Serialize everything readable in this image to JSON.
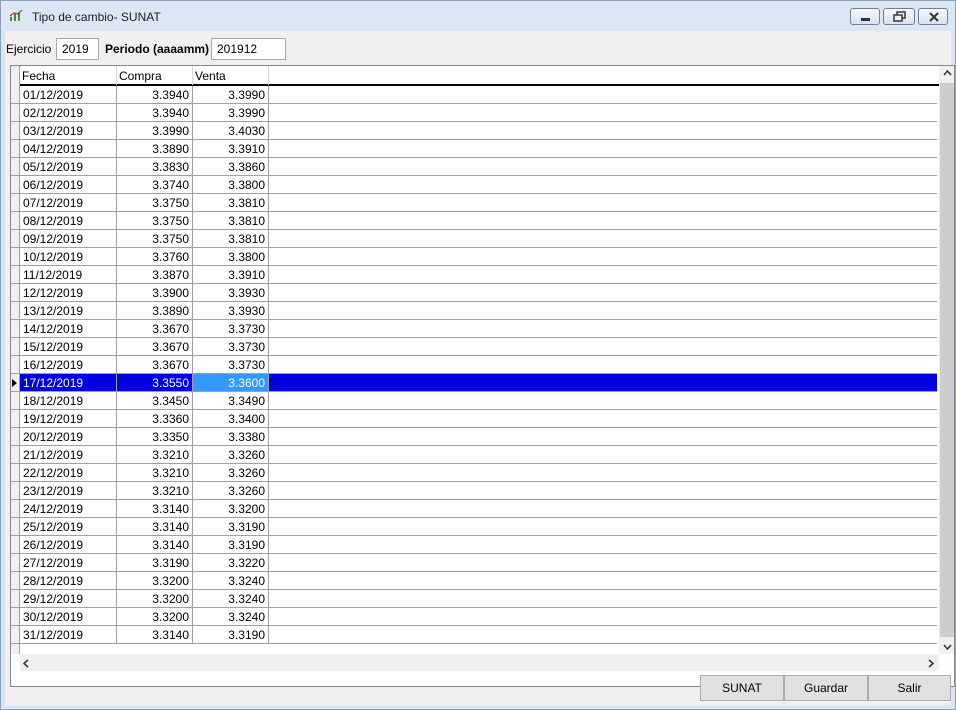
{
  "window": {
    "title": "Tipo de cambio- SUNAT"
  },
  "filters": {
    "ejercicio_label": "Ejercicio",
    "ejercicio_value": "2019",
    "periodo_label": "Periodo (aaaamm)",
    "periodo_value": "201912"
  },
  "grid": {
    "columns": [
      "Fecha",
      "Compra",
      "Venta"
    ],
    "selected_index": 16,
    "rows": [
      {
        "fecha": "01/12/2019",
        "compra": "3.3940",
        "venta": "3.3990"
      },
      {
        "fecha": "02/12/2019",
        "compra": "3.3940",
        "venta": "3.3990"
      },
      {
        "fecha": "03/12/2019",
        "compra": "3.3990",
        "venta": "3.4030"
      },
      {
        "fecha": "04/12/2019",
        "compra": "3.3890",
        "venta": "3.3910"
      },
      {
        "fecha": "05/12/2019",
        "compra": "3.3830",
        "venta": "3.3860"
      },
      {
        "fecha": "06/12/2019",
        "compra": "3.3740",
        "venta": "3.3800"
      },
      {
        "fecha": "07/12/2019",
        "compra": "3.3750",
        "venta": "3.3810"
      },
      {
        "fecha": "08/12/2019",
        "compra": "3.3750",
        "venta": "3.3810"
      },
      {
        "fecha": "09/12/2019",
        "compra": "3.3750",
        "venta": "3.3810"
      },
      {
        "fecha": "10/12/2019",
        "compra": "3.3760",
        "venta": "3.3800"
      },
      {
        "fecha": "11/12/2019",
        "compra": "3.3870",
        "venta": "3.3910"
      },
      {
        "fecha": "12/12/2019",
        "compra": "3.3900",
        "venta": "3.3930"
      },
      {
        "fecha": "13/12/2019",
        "compra": "3.3890",
        "venta": "3.3930"
      },
      {
        "fecha": "14/12/2019",
        "compra": "3.3670",
        "venta": "3.3730"
      },
      {
        "fecha": "15/12/2019",
        "compra": "3.3670",
        "venta": "3.3730"
      },
      {
        "fecha": "16/12/2019",
        "compra": "3.3670",
        "venta": "3.3730"
      },
      {
        "fecha": "17/12/2019",
        "compra": "3.3550",
        "venta": "3.3600"
      },
      {
        "fecha": "18/12/2019",
        "compra": "3.3450",
        "venta": "3.3490"
      },
      {
        "fecha": "19/12/2019",
        "compra": "3.3360",
        "venta": "3.3400"
      },
      {
        "fecha": "20/12/2019",
        "compra": "3.3350",
        "venta": "3.3380"
      },
      {
        "fecha": "21/12/2019",
        "compra": "3.3210",
        "venta": "3.3260"
      },
      {
        "fecha": "22/12/2019",
        "compra": "3.3210",
        "venta": "3.3260"
      },
      {
        "fecha": "23/12/2019",
        "compra": "3.3210",
        "venta": "3.3260"
      },
      {
        "fecha": "24/12/2019",
        "compra": "3.3140",
        "venta": "3.3200"
      },
      {
        "fecha": "25/12/2019",
        "compra": "3.3140",
        "venta": "3.3190"
      },
      {
        "fecha": "26/12/2019",
        "compra": "3.3140",
        "venta": "3.3190"
      },
      {
        "fecha": "27/12/2019",
        "compra": "3.3190",
        "venta": "3.3220"
      },
      {
        "fecha": "28/12/2019",
        "compra": "3.3200",
        "venta": "3.3240"
      },
      {
        "fecha": "29/12/2019",
        "compra": "3.3200",
        "venta": "3.3240"
      },
      {
        "fecha": "30/12/2019",
        "compra": "3.3200",
        "venta": "3.3240"
      },
      {
        "fecha": "31/12/2019",
        "compra": "3.3140",
        "venta": "3.3190"
      }
    ]
  },
  "buttons": {
    "sunat": "SUNAT",
    "guardar": "Guardar",
    "salir": "Salir"
  },
  "colors": {
    "selection": "#0000e0",
    "selection_cell": "#3399ff"
  },
  "icons": {
    "app": "chart-icon",
    "minimize": "minimize-icon",
    "restore": "restore-icon",
    "close": "close-icon",
    "scroll_up": "chevron-up-icon",
    "scroll_down": "chevron-down-icon",
    "scroll_left": "chevron-left-icon",
    "scroll_right": "chevron-right-icon",
    "row_pointer": "row-pointer-icon"
  }
}
